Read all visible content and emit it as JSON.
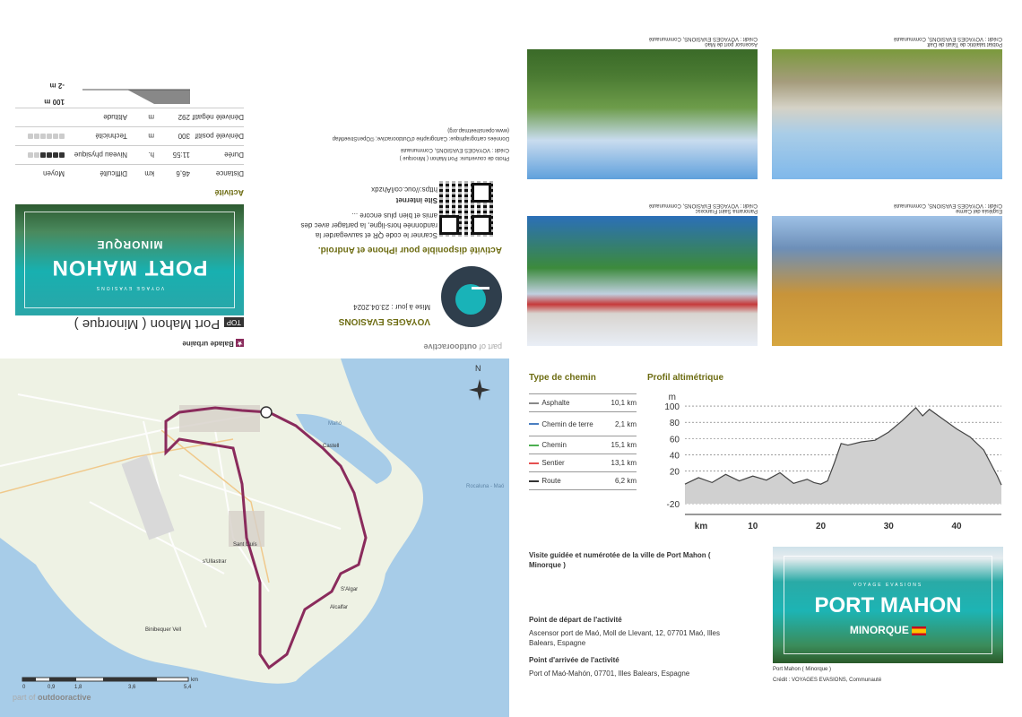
{
  "brand": {
    "part_of": "part of",
    "name": "outdooractive"
  },
  "header": {
    "category": "Balade urbaine",
    "top_badge": "TOP",
    "title": "Port Mahon ( Minorque )",
    "author": "VOYAGES EVASIONS",
    "updated": "Mise à jour : 23.04.2024"
  },
  "cover": {
    "title": "PORT MAHON",
    "subtitle": "MINORQUE",
    "small": "VOYAGE EVASIONS"
  },
  "activity": {
    "heading": "Activité",
    "rows": [
      {
        "label": "Distance",
        "value": "46,6",
        "unit": "km"
      },
      {
        "label": "Durée",
        "value": "11:55",
        "unit": "h."
      },
      {
        "label": "Dénivelé positif",
        "value": "300",
        "unit": "m"
      },
      {
        "label": "Dénivelé négatif",
        "value": "292",
        "unit": "m"
      }
    ],
    "difficulty_label": "Difficulté",
    "difficulty_value": "Moyen",
    "fitness_label": "Niveau physique",
    "fitness_level": 4,
    "technique_label": "Technicité",
    "technique_level": 0,
    "altitude_label": "Altitude",
    "alt_max": "100 m",
    "alt_min": "-2 m"
  },
  "app": {
    "heading": "Activité disponible pour iPhone et Android.",
    "text": "Scanner le code QR et sauvegarder la randonnée hors-ligne, la partager avec des amis et bien plus encore ...",
    "site_label": "Site internet",
    "url": "https://ouc.co/iAhzdx"
  },
  "credits": {
    "cover_photo": "Photo de couverture: Port Mahon ( Minorque )",
    "cover_credit": "Crédit : VOYAGES EVASIONS, Communauté",
    "carto": "Données cartographique: Cartographie d'Outdooractive; ©OpenStreetMap",
    "carto_url": "(www.openstreetmap.org)"
  },
  "photos": [
    {
      "title": "Panorama Saint Francesc",
      "credit": "Crédit : VOYAGES EVASIONS, Communauté"
    },
    {
      "title": "Església del Carme",
      "credit": "Crédit : VOYAGES EVASIONS, Communauté"
    },
    {
      "title": "Ascensor port de Maó",
      "credit": "Crédit : VOYAGES EVASIONS, Communauté"
    },
    {
      "title": "Poblat talaiòtic de Talati de Dalt",
      "credit": "Crédit : VOYAGES EVASIONS, Communauté"
    }
  ],
  "map": {
    "compass": "N",
    "places": [
      "Castell",
      "Sant Lluís",
      "s'Ullastrar",
      "S'Algar",
      "Alcalfar",
      "Binibequer Vell",
      "Mahó",
      "Rocaluna - Maó"
    ],
    "scale": {
      "unit": "km",
      "ticks": [
        "0",
        "0,9",
        "1,8",
        "3,6",
        "5,4"
      ]
    }
  },
  "path_types": {
    "heading": "Type de chemin",
    "rows": [
      {
        "name": "Asphalte",
        "km": "10,1 km",
        "color": "#888888"
      },
      {
        "name": "Chemin de terre",
        "km": "2,1 km",
        "color": "#4a7fc1"
      },
      {
        "name": "Chemin",
        "km": "15,1 km",
        "color": "#4caf50"
      },
      {
        "name": "Sentier",
        "km": "13,1 km",
        "color": "#e55050"
      },
      {
        "name": "Route",
        "km": "6,2 km",
        "color": "#333333"
      }
    ]
  },
  "chart_data": {
    "type": "area",
    "title": "Profil altimétrique",
    "ylabel": "m",
    "xlabel": "km",
    "yticks": [
      "100",
      "80",
      "60",
      "40",
      "20",
      "-20"
    ],
    "xticks": [
      "10",
      "20",
      "30",
      "40"
    ],
    "ylim": [
      -20,
      110
    ],
    "xlim": [
      0,
      46.6
    ],
    "x": [
      0,
      2,
      4,
      6,
      8,
      10,
      12,
      14,
      16,
      18,
      19,
      20,
      21,
      22,
      23,
      24,
      26,
      28,
      30,
      32,
      33,
      34,
      35,
      36,
      38,
      40,
      42,
      44,
      45,
      46,
      46.6
    ],
    "y": [
      4,
      12,
      6,
      16,
      8,
      14,
      9,
      18,
      5,
      10,
      6,
      4,
      8,
      30,
      54,
      52,
      56,
      58,
      68,
      82,
      90,
      98,
      88,
      96,
      84,
      72,
      62,
      46,
      30,
      14,
      3
    ]
  },
  "description": {
    "intro": "Visite guidée et numérotée de la ville de Port Mahon ( Minorque )",
    "start_label": "Point de départ de l'activité",
    "start": "Ascensor port de Maó, Moll de Llevant, 12, 07701 Maó, Illes Balears, Espagne",
    "end_label": "Point d'arrivée de l'activité",
    "end": "Port of Maó-Mahón,  07701, Illes Balears, Espagne"
  },
  "thumb": {
    "title": "PORT MAHON",
    "subtitle": "MINORQUE",
    "small": "VOYAGE EVASIONS",
    "caption": "Port Mahon ( Minorque )",
    "credit": "Crédit : VOYAGES EVASIONS, Communauté"
  }
}
